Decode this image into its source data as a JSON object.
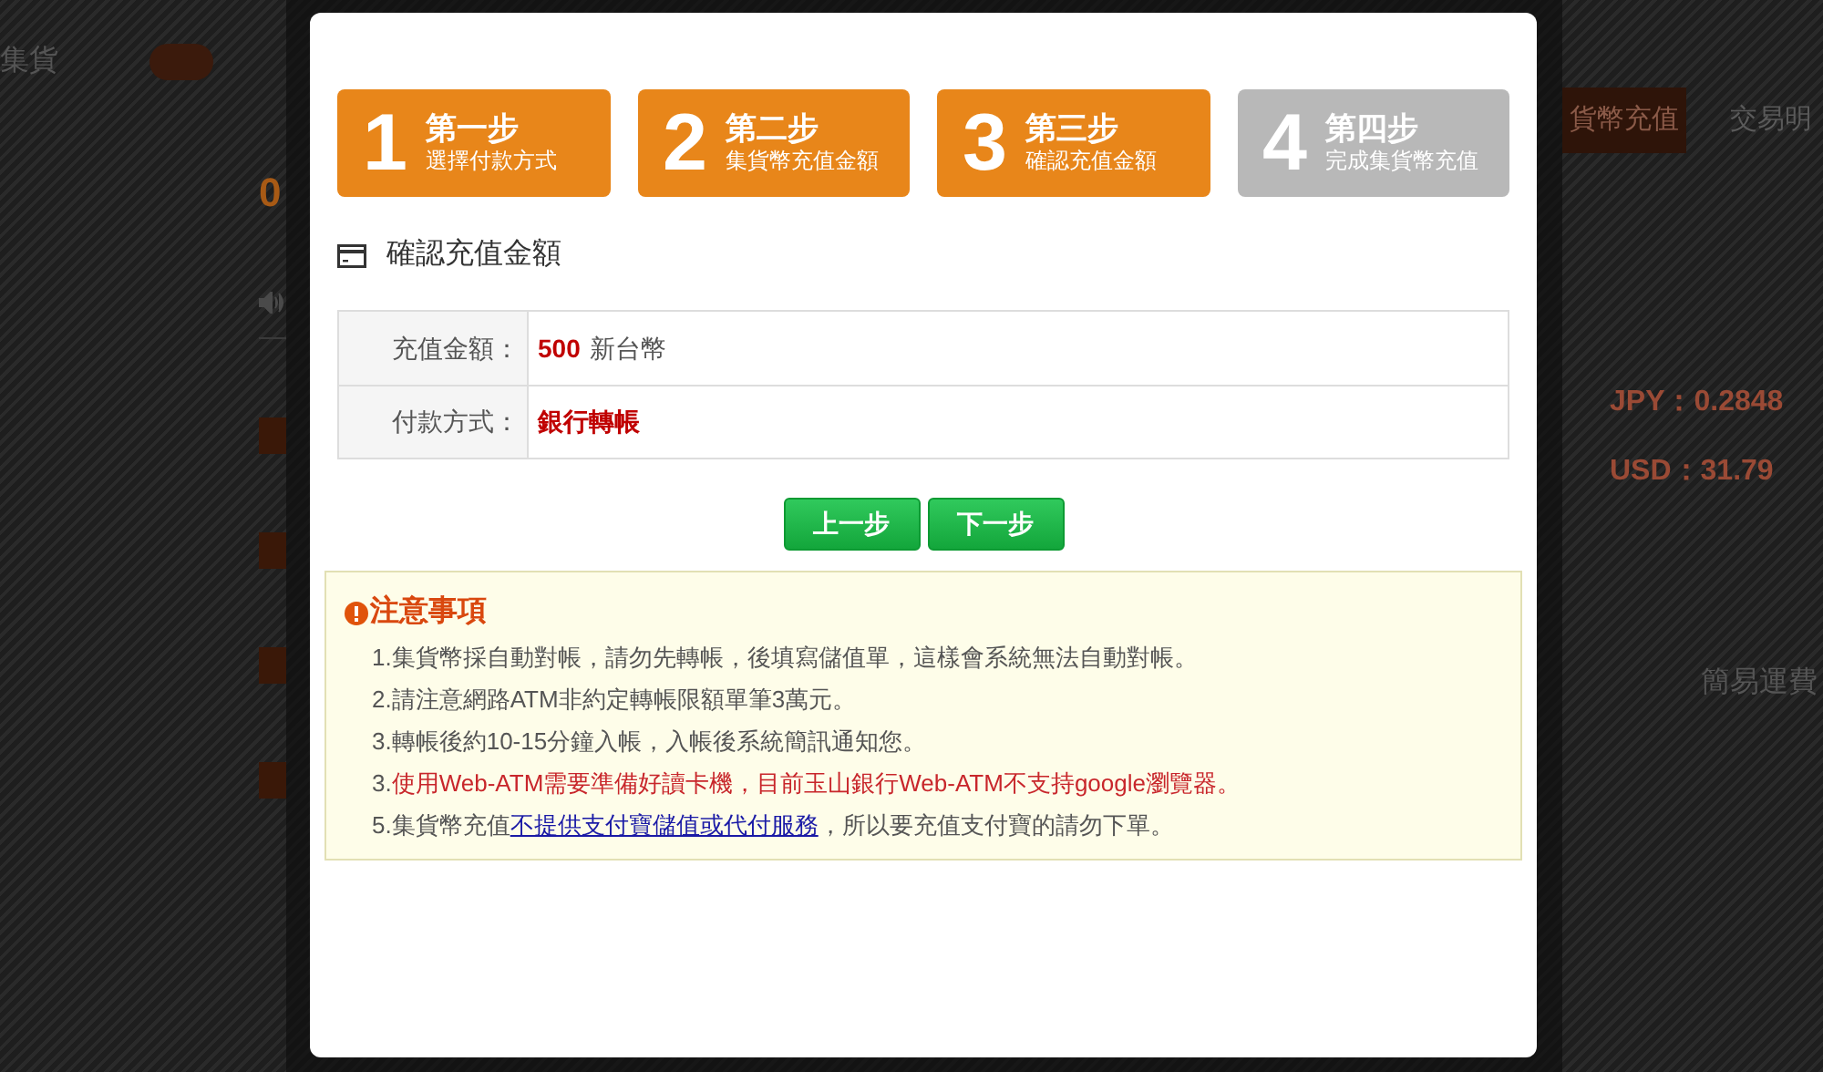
{
  "background_page": {
    "sidebar": {
      "title": "集貨",
      "balance": "0"
    },
    "right_panel": {
      "tabs": [
        {
          "label": "貨幣充值",
          "selected": true
        },
        {
          "label": "交易明",
          "selected": false
        }
      ],
      "rates": [
        "JPY：0.2848",
        "USD：31.79"
      ],
      "link": "簡易運費"
    }
  },
  "modal": {
    "steps": [
      {
        "number": "1",
        "title": "第一步",
        "subtitle": "選擇付款方式",
        "done": true
      },
      {
        "number": "2",
        "title": "第二步",
        "subtitle": "集貨幣充值金額",
        "done": true
      },
      {
        "number": "3",
        "title": "第三步",
        "subtitle": "確認充值金額",
        "done": true
      },
      {
        "number": "4",
        "title": "第四步",
        "subtitle": "完成集貨幣充值",
        "done": false
      }
    ],
    "section_title": "確認充值金額",
    "table": {
      "rows": [
        {
          "label": "充值金額：",
          "value": "500",
          "unit": "新台幣"
        },
        {
          "label": "付款方式：",
          "value": "銀行轉帳"
        }
      ]
    },
    "buttons": [
      "上一步",
      "下一步"
    ],
    "notice": {
      "title": "注意事項",
      "items": [
        {
          "segments": [
            {
              "kind": "plain",
              "text": "1.集貨幣採自動對帳，請勿先轉帳，後填寫儲值單，這樣會系統無法自動對帳。"
            }
          ]
        },
        {
          "segments": [
            {
              "kind": "plain",
              "text": "2.請注意網路ATM非約定轉帳限額單筆3萬元。"
            }
          ]
        },
        {
          "segments": [
            {
              "kind": "plain",
              "text": "3.轉帳後約10-15分鐘入帳，入帳後系統簡訊通知您。"
            }
          ]
        },
        {
          "segments": [
            {
              "kind": "plain",
              "text": "3."
            },
            {
              "kind": "warning",
              "text": "使用Web-ATM需要準備好讀卡機，目前玉山銀行Web-ATM不支持google瀏覽器。"
            }
          ]
        },
        {
          "segments": [
            {
              "kind": "plain",
              "text": "5.集貨幣充值"
            },
            {
              "kind": "link",
              "text": "不提供支付寶儲值或代付服務"
            },
            {
              "kind": "plain",
              "text": "，所以要充值支付寶的請勿下單。"
            }
          ]
        }
      ]
    }
  }
}
